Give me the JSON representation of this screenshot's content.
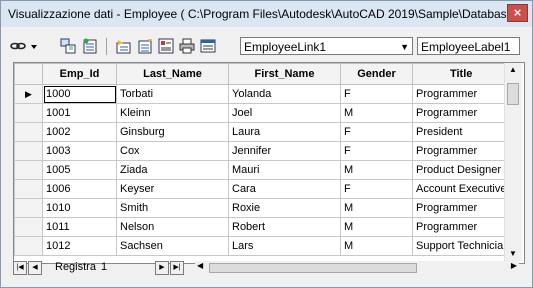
{
  "window": {
    "title": "Visualizzazione dati - Employee ( C:\\Program Files\\Autodesk\\AutoCAD 2019\\Sample\\Database Connectivity\\db_samples.mdb )",
    "close_label": "×"
  },
  "toolbar": {
    "link_template": "EmployeeLink1",
    "label_template": "EmployeeLabel1"
  },
  "grid": {
    "columns": [
      "Emp_Id",
      "Last_Name",
      "First_Name",
      "Gender",
      "Title"
    ],
    "rows": [
      [
        "1000",
        "Torbati",
        "Yolanda",
        "F",
        "Programmer"
      ],
      [
        "1001",
        "Kleinn",
        "Joel",
        "M",
        "Programmer"
      ],
      [
        "1002",
        "Ginsburg",
        "Laura",
        "F",
        "President"
      ],
      [
        "1003",
        "Cox",
        "Jennifer",
        "F",
        "Programmer"
      ],
      [
        "1005",
        "Ziada",
        "Mauri",
        "M",
        "Product Designer"
      ],
      [
        "1006",
        "Keyser",
        "Cara",
        "F",
        "Account Executive"
      ],
      [
        "1010",
        "Smith",
        "Roxie",
        "M",
        "Programmer"
      ],
      [
        "1011",
        "Nelson",
        "Robert",
        "M",
        "Programmer"
      ],
      [
        "1012",
        "Sachsen",
        "Lars",
        "M",
        "Support Technician"
      ]
    ],
    "current_row_marker": "▶"
  },
  "navigator": {
    "label": "Registra",
    "record": "1"
  }
}
